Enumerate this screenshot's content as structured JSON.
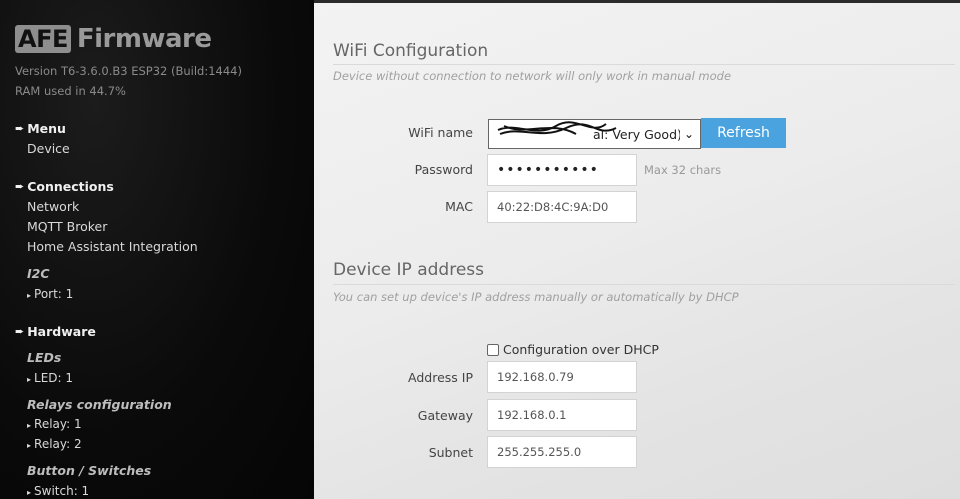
{
  "sidebar": {
    "logo_badge": "AFE",
    "logo_text": "Firmware",
    "version": "Version T6-3.6.0.B3 ESP32 (Build:1444)",
    "ram": "RAM used in 44.7%",
    "menu": {
      "heading": "Menu",
      "items": [
        "Device"
      ]
    },
    "connections": {
      "heading": "Connections",
      "items": [
        "Network",
        "MQTT Broker",
        "Home Assistant Integration"
      ]
    },
    "i2c": {
      "label": "I2C",
      "items": [
        "Port: 1"
      ]
    },
    "hardware": {
      "heading": "Hardware"
    },
    "leds": {
      "label": "LEDs",
      "items": [
        "LED: 1"
      ]
    },
    "relays": {
      "label": "Relays configuration",
      "items": [
        "Relay: 1",
        "Relay: 2"
      ]
    },
    "buttons": {
      "label": "Button / Switches",
      "items": [
        "Switch: 1"
      ]
    }
  },
  "wifi": {
    "title": "WiFi Configuration",
    "hint": "Device without connection to network will only work in manual mode",
    "name_label": "WiFi name",
    "name_value": "al: Very Good)",
    "refresh_label": "Refresh",
    "password_label": "Password",
    "password_value": "•••••••••••",
    "password_hint": "Max 32 chars",
    "mac_label": "MAC",
    "mac_value": "40:22:D8:4C:9A:D0"
  },
  "ip": {
    "title": "Device IP address",
    "hint": "You can set up device's IP address manually or automatically by DHCP",
    "dhcp_label": "Configuration over DHCP",
    "dhcp_checked": false,
    "address_label": "Address IP",
    "address_value": "192.168.0.79",
    "gateway_label": "Gateway",
    "gateway_value": "192.168.0.1",
    "subnet_label": "Subnet",
    "subnet_value": "255.255.255.0"
  },
  "colors": {
    "accent": "#4aa3df",
    "sidebar_bg": "#0a0a0a",
    "main_bg": "#ececec"
  }
}
